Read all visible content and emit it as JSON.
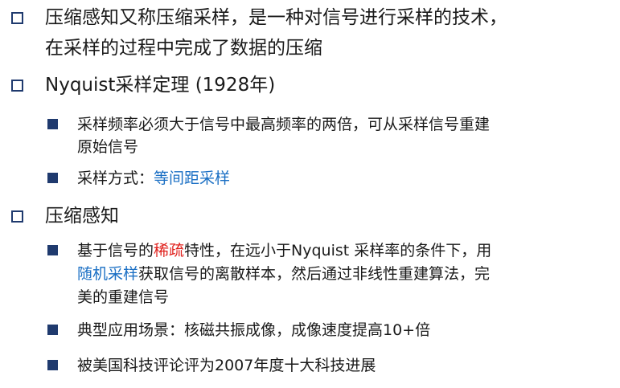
{
  "bullets": {
    "b1": {
      "line1": "压缩感知又称压缩采样，是一种对信号进行采样的技术，",
      "line2": "在采样的过程中完成了数据的压缩"
    },
    "b2": {
      "title": "Nyquist采样定理 (1928年)",
      "sub1": {
        "line1": "采样频率必须大于信号中最高频率的两倍，可从采样信号重建",
        "line2": "原始信号"
      },
      "sub2": {
        "prefix": "采样方式：",
        "highlight": "等间距采样"
      }
    },
    "b3": {
      "title": "压缩感知",
      "sub1": {
        "line1_a": "基于信号的",
        "line1_red": "稀疏",
        "line1_b": "特性，在远小于Nyquist 采样率的条件下，用",
        "line2_blue": "随机采样",
        "line2_b": "获取信号的离散样本，然后通过非线性重建算法，完",
        "line3": "美的重建信号"
      },
      "sub2": "典型应用场景：核磁共振成像，成像速度提高10+倍",
      "sub3": "被美国科技评论评为2007年度十大科技进展"
    }
  },
  "colors": {
    "bullet": "#1f3a6e",
    "highlight_blue": "#1a6fc4",
    "highlight_red": "#e0201c"
  }
}
